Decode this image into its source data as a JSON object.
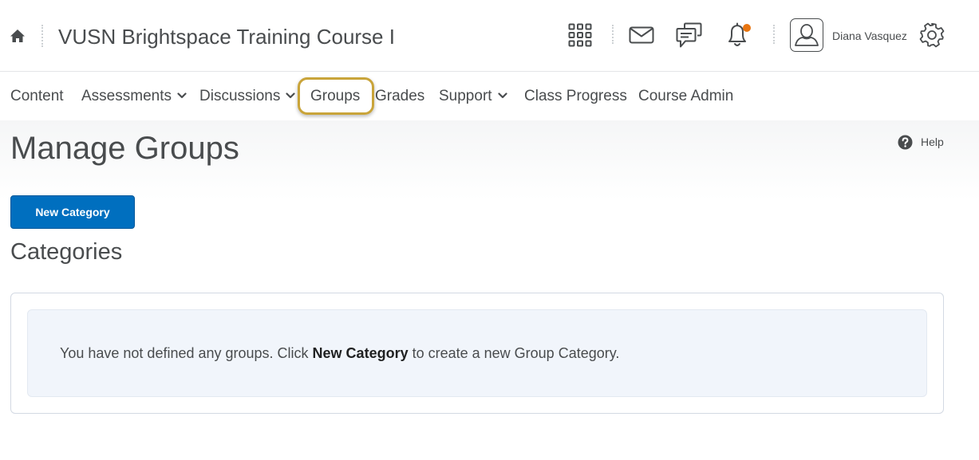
{
  "header": {
    "course_title": "VUSN Brightspace Training Course I",
    "user_name": "Diana Vasquez",
    "notification_dot_color": "#e87511"
  },
  "nav": {
    "items": [
      {
        "label": "Content",
        "has_menu": false
      },
      {
        "label": "Assessments",
        "has_menu": true
      },
      {
        "label": "Discussions",
        "has_menu": true
      },
      {
        "label": "Groups",
        "has_menu": false,
        "highlighted": true
      },
      {
        "label": "Grades",
        "has_menu": false
      },
      {
        "label": "Support",
        "has_menu": true
      },
      {
        "label": "Class Progress",
        "has_menu": false
      },
      {
        "label": "Course Admin",
        "has_menu": false
      }
    ],
    "highlight_color": "#c9a43a"
  },
  "page": {
    "title": "Manage Groups",
    "help_label": "Help",
    "new_category_button": "New Category",
    "categories_heading": "Categories",
    "empty_message": {
      "before": "You have not defined any groups. Click ",
      "emphasis": "New Category",
      "after": " to create a new Group Category."
    }
  },
  "colors": {
    "primary_button": "#006fbf",
    "text": "#494c4e"
  }
}
